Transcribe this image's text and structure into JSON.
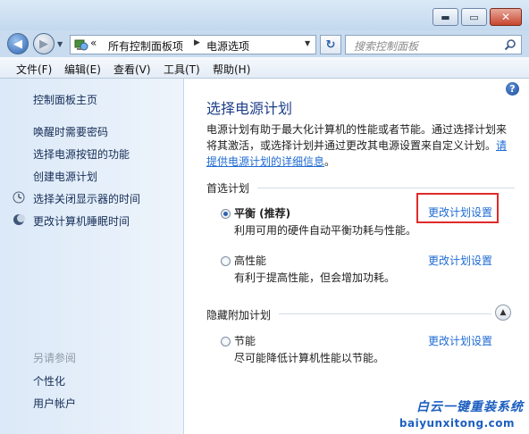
{
  "window": {
    "buttons": {
      "minimize": "▬",
      "maximize": "▭",
      "close": "✕"
    }
  },
  "nav": {
    "back_glyph": "◀",
    "forward_glyph": "▶",
    "address": {
      "prefix": "«",
      "crumbs": [
        "所有控制面板项",
        "电源选项"
      ],
      "separator": "▶"
    },
    "refresh_glyph": "↻",
    "search_placeholder": "搜索控制面板"
  },
  "menu": [
    "文件(F)",
    "编辑(E)",
    "查看(V)",
    "工具(T)",
    "帮助(H)"
  ],
  "sidebar": {
    "home": "控制面板主页",
    "links": [
      {
        "label": "唤醒时需要密码",
        "icon": ""
      },
      {
        "label": "选择电源按钮的功能",
        "icon": ""
      },
      {
        "label": "创建电源计划",
        "icon": ""
      },
      {
        "label": "选择关闭显示器的时间",
        "icon": "monitor-clock-icon"
      },
      {
        "label": "更改计算机睡眠时间",
        "icon": "moon-icon"
      }
    ],
    "see_also_heading": "另请参阅",
    "see_also": [
      "个性化",
      "用户帐户"
    ]
  },
  "main": {
    "help_glyph": "?",
    "title": "选择电源计划",
    "intro_text": "电源计划有助于最大化计算机的性能或者节能。通过选择计划来将其激活，或选择计划并通过更改其电源设置来自定义计划。",
    "intro_link": "请提供电源计划的详细信息",
    "intro_end": "。",
    "preferred_label": "首选计划",
    "hidden_label": "隐藏附加计划",
    "plans": [
      {
        "name": "平衡 (推荐)",
        "desc": "利用可用的硬件自动平衡功耗与性能。",
        "link": "更改计划设置",
        "selected": true
      },
      {
        "name": "高性能",
        "desc": "有利于提高性能，但会增加功耗。",
        "link": "更改计划设置",
        "selected": false
      },
      {
        "name": "节能",
        "desc": "尽可能降低计算机性能以节能。",
        "link": "更改计划设置",
        "selected": false
      }
    ],
    "collapse_glyph": "▲"
  },
  "watermark": {
    "line1": "白云一键重装系统",
    "line2": "baiyunxitong.com"
  },
  "colors": {
    "link": "#1f6bd3",
    "title": "#1e3f8a",
    "highlight": "#e02a2a"
  }
}
